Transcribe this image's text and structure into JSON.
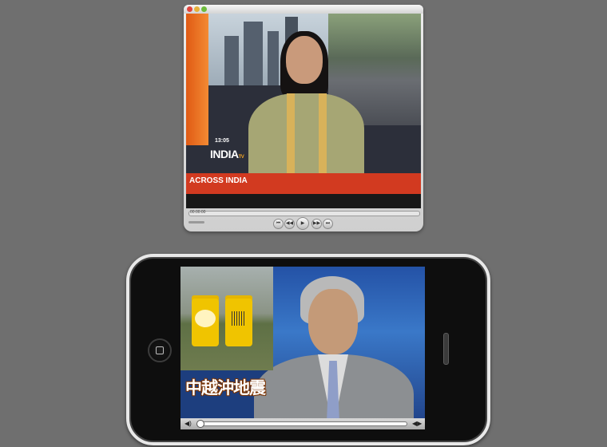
{
  "top_player": {
    "video": {
      "clock": "13:05",
      "channel_logo": "INDIA",
      "channel_logo_sub": "TV",
      "ticker": "ACROSS INDIA"
    },
    "timecode": "00:00:00",
    "buttons": [
      "previous-icon",
      "rewind-icon",
      "play-icon",
      "fast-forward-icon",
      "next-icon"
    ]
  },
  "phone_player": {
    "inset_labels": [
      "Colman's Mustard"
    ],
    "caption": "中越沖地震",
    "buttons": [
      "volume-icon",
      "fullscreen-icon"
    ]
  },
  "colors": {
    "background": "#6f6f6f",
    "ticker_red": "#d23a20",
    "news_blue": "#2452a6"
  }
}
